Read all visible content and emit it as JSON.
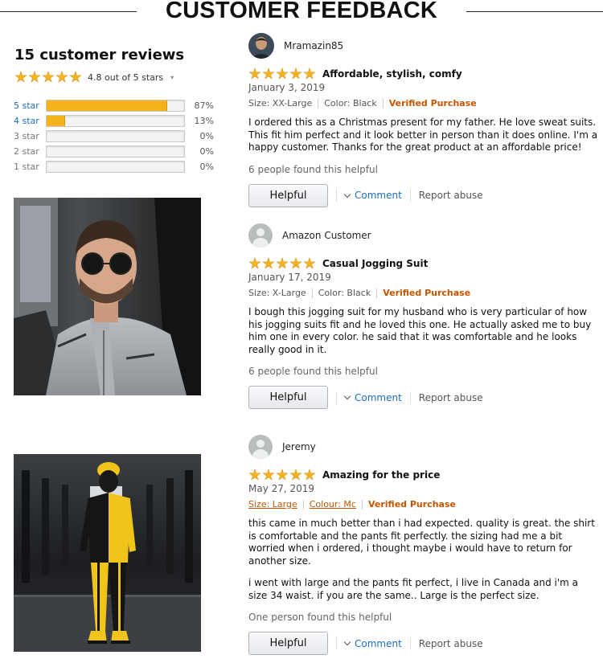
{
  "header": {
    "title": "CUSTOMER FEEDBACK"
  },
  "summary": {
    "title": "15 customer reviews",
    "rating_text": "4.8 out of 5 stars",
    "histogram": [
      {
        "label": "5 star",
        "pct_text": "87%",
        "percent": 87,
        "link": true
      },
      {
        "label": "4 star",
        "pct_text": "13%",
        "percent": 13,
        "link": true
      },
      {
        "label": "3 star",
        "pct_text": "0%",
        "percent": 0,
        "link": false
      },
      {
        "label": "2 star",
        "pct_text": "0%",
        "percent": 0,
        "link": false
      },
      {
        "label": "1 star",
        "pct_text": "0%",
        "percent": 0,
        "link": false
      }
    ]
  },
  "reviews": [
    {
      "user": "Mramazin85",
      "title": "Affordable, stylish, comfy",
      "date": "January 3, 2019",
      "size": "Size: XX-Large",
      "color": "Color: Black",
      "verified": "Verified Purchase",
      "body": [
        "I ordered this as a Christmas present for my father. He love sweat suits. This fit him perfect and it look better in person than it does online. I'm a happy customer. Thanks for the great product at an affordable price!"
      ],
      "helpful_text": "6 people found this helpful"
    },
    {
      "user": "Amazon Customer",
      "title": "Casual Jogging Suit",
      "date": "January 17, 2019",
      "size": "Size: X-Large",
      "color": "Color: Black",
      "verified": "Verified Purchase",
      "body": [
        "I bough this jogging suit for my husband who is very particular of how his jogging suits fit and he loved this one. He actually asked me to buy him one in every color. he said that it was comfortable and he looks really good in it."
      ],
      "helpful_text": "6 people found this helpful"
    },
    {
      "user": "Jeremy",
      "title": "Amazing for the price",
      "date": "May 27, 2019",
      "size": "Size: Large",
      "color": "Colour: Mc",
      "verified": "Verified Purchase",
      "body": [
        "this came in much better than i had expected. quality is great. the shirt is comfortable and the pants fit perfectly. the sizing had me a bit worried when i ordered, i thought maybe i would have to return for another size.",
        "i went with large and the pants fit perfect, i live in Canada and i'm a size 34 waist. if you are the same.. Large is the perfect size."
      ],
      "helpful_text": "One person found this helpful"
    }
  ],
  "actions": {
    "helpful": "Helpful",
    "comment": "Comment",
    "report": "Report abuse"
  },
  "colors": {
    "star": "#f5b21b",
    "link": "#1a6ec0",
    "verified": "#c45500"
  }
}
